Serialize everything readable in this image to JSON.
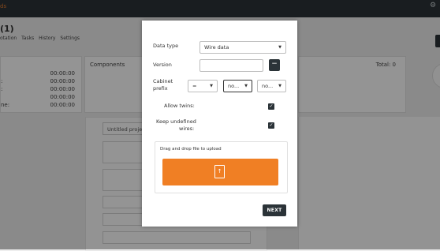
{
  "app": {
    "brand_fragment": "ds"
  },
  "header": {
    "title_fragment": "(1)"
  },
  "tabs": [
    {
      "label": "otation"
    },
    {
      "label": "Tasks"
    },
    {
      "label": "History"
    },
    {
      "label": "Settings"
    }
  ],
  "time_card": {
    "rows": [
      {
        "prefix": "",
        "value": "00:00:00"
      },
      {
        "prefix": ":",
        "value": "00:00:00"
      },
      {
        "prefix": ":",
        "value": "00:00:00"
      },
      {
        "prefix": "",
        "value": "00:00:00"
      },
      {
        "prefix": "ne:",
        "value": "00:00:00"
      }
    ]
  },
  "components_card": {
    "title": "Components",
    "total_label": "Total: 0"
  },
  "project": {
    "name": "Untitled projec"
  },
  "modal": {
    "data_type": {
      "label": "Data type",
      "value": "Wire data"
    },
    "version": {
      "label": "Version",
      "value": ""
    },
    "cabinet_prefix": {
      "label_line1": "Cabinet",
      "label_line2": "prefix",
      "selects": [
        "=",
        "no...",
        "no..."
      ]
    },
    "allow_twins": {
      "label": "Allow twins:",
      "checked": true
    },
    "keep_undefined": {
      "label_line1": "Keep undefined",
      "label_line2": "wires:",
      "checked": true
    },
    "upload": {
      "label": "Drag and drop file to upload"
    },
    "next_label": "NEXT"
  }
}
